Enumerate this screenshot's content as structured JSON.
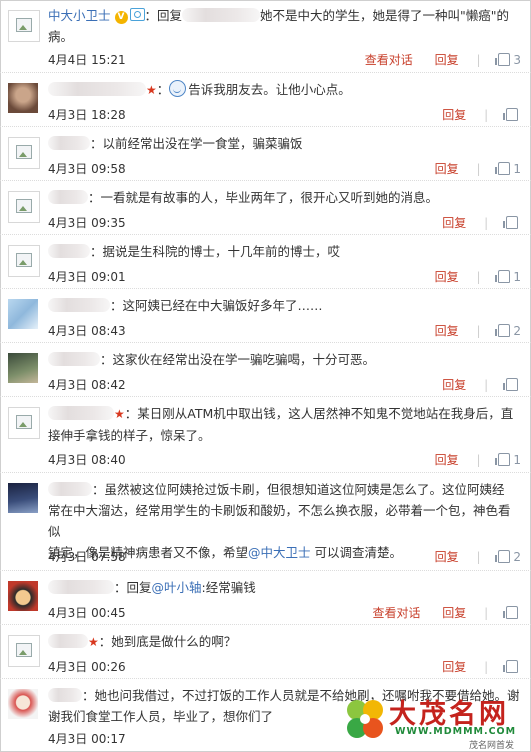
{
  "comments": [
    {
      "user": "中大小卫士",
      "text_parts": {
        "reply_prefix": "回复",
        "reply_tail": "她不是中大的学生，她是得了一种叫\"懒癌\"的",
        "line2": "病。"
      },
      "time": "4月4日 15:21",
      "view_thread": "查看对话",
      "reply": "回复",
      "likes": "3"
    },
    {
      "text": "告诉我朋友去。让他小心点。",
      "time": "4月3日 18:28",
      "reply": "回复",
      "likes": ""
    },
    {
      "text": "：以前经常出没在学一食堂，骗菜骗饭",
      "time": "4月3日 09:58",
      "reply": "回复",
      "likes": "1"
    },
    {
      "text": "：一看就是有故事的人，毕业两年了，很开心又听到她的消息。",
      "time": "4月3日 09:35",
      "reply": "回复",
      "likes": ""
    },
    {
      "text": "：据说是生科院的博士，十几年前的博士，哎",
      "time": "4月3日 09:01",
      "reply": "回复",
      "likes": "1"
    },
    {
      "text": "：这阿姨已经在中大骗饭好多年了……",
      "time": "4月3日 08:43",
      "reply": "回复",
      "likes": "2"
    },
    {
      "text": "：这家伙在经常出没在学一骗吃骗喝，十分可恶。",
      "time": "4月3日 08:42",
      "reply": "回复",
      "likes": ""
    },
    {
      "text": "：某日刚从ATM机中取出钱，这人居然神不知鬼不觉地站在我身后，直",
      "line2": "接伸手拿钱的样子，惊呆了。",
      "time": "4月3日 08:40",
      "reply": "回复",
      "likes": "1"
    },
    {
      "text": "：虽然被这位阿姨抢过饭卡刷，但很想知道这位阿姨是怎么了。这位阿姨经",
      "line2": "常在中大溜达，经常用学生的卡刷饭和酸奶，不怎么换衣服，必带着一个包，神色看似",
      "line3_a": "镇定，像是精神病患者又不像，希望",
      "mention": "@中大卫士",
      "line3_b": " 可以调查清楚。",
      "time": "4月3日 07:58",
      "reply": "回复",
      "likes": "2"
    },
    {
      "text_a": "：回复",
      "mention": "@叶小轴",
      "text_b": ":经常骗钱",
      "time": "4月3日 00:45",
      "view_thread": "查看对话",
      "reply": "回复",
      "likes": ""
    },
    {
      "text": "：她到底是做什么的啊？",
      "time": "4月3日 00:26",
      "reply": "回复",
      "likes": ""
    },
    {
      "text": "：她也问我借过，不过打饭的工作人员就是不给她刷，还嘱咐我不要借给她。谢",
      "line2": "谢我们食堂工作人员，毕业了，想你们了",
      "time": "4月3日 00:17",
      "reply": "回复",
      "likes": ""
    }
  ],
  "watermark": {
    "name": "大茂名网",
    "url": "WWW.MDMMM.COM",
    "sub": "茂名网首发"
  },
  "colors": {
    "link": "#3b6fb6",
    "action": "#c8402c",
    "star": "#d8381f"
  },
  "icons": {
    "like": "thumbs-up-icon",
    "avatar": "avatar-placeholder-icon",
    "verified": "v-badge-icon"
  }
}
